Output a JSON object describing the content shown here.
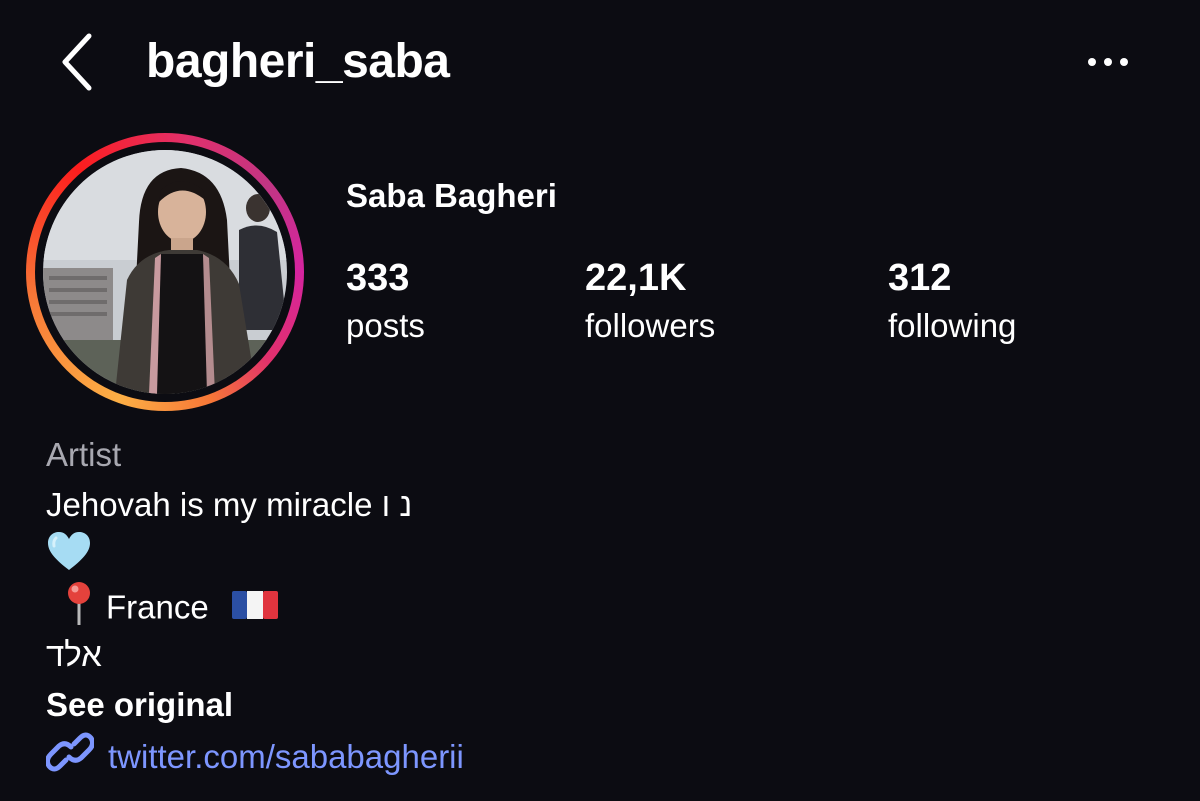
{
  "header": {
    "username": "bagheri_saba",
    "back_icon": "chevron-left-icon",
    "more_icon": "ellipsis-icon"
  },
  "profile": {
    "display_name": "Saba Bagheri",
    "avatar": "profile-photo",
    "story_ring_colors": [
      "#fcaf45",
      "#f77737",
      "#fd1d1d",
      "#e1306c",
      "#c13584",
      "#d6249f"
    ]
  },
  "stats": {
    "posts": {
      "value": "333",
      "label": "posts"
    },
    "followers": {
      "value": "22,1K",
      "label": "followers"
    },
    "following": {
      "value": "312",
      "label": "following"
    }
  },
  "bio": {
    "category": "Artist",
    "line1": "Jehovah is my miracle נ ו",
    "heart_icon": "light-blue-heart-icon",
    "location_pin_icon": "round-pushpin-icon",
    "location": "France",
    "flag_icon": "france-flag-icon",
    "hebrew": "אלד",
    "see_original": "See original",
    "link": "twitter.com/sababagherii",
    "link_icon": "link-icon"
  },
  "colors": {
    "background": "#0c0c12",
    "text": "#ffffff",
    "secondary_text": "#a8a8b0",
    "link": "#7d96ff"
  }
}
